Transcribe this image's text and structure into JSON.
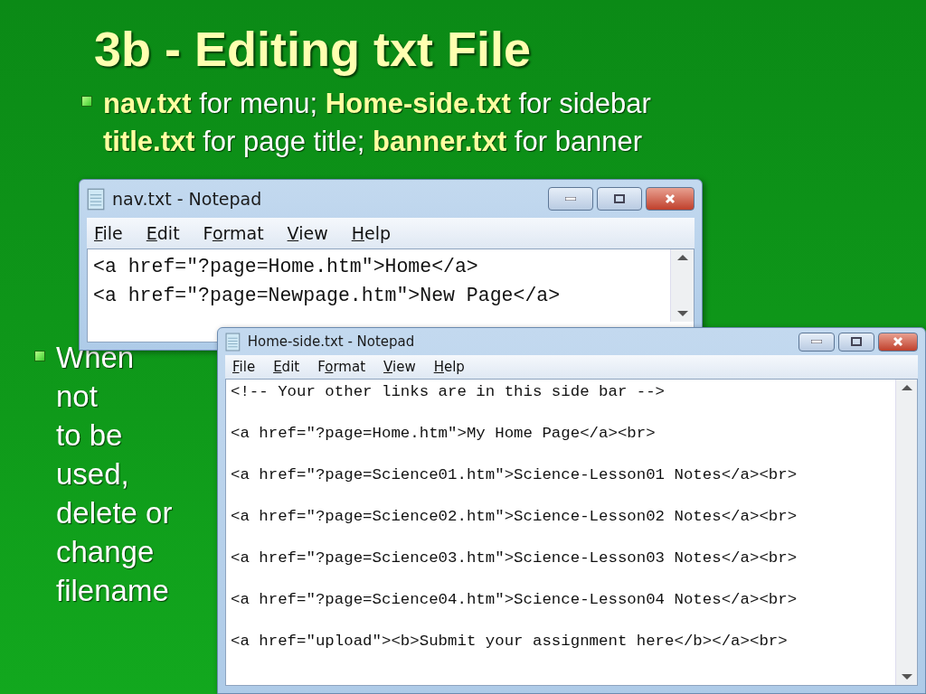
{
  "slide": {
    "title": "3b - Editing txt File",
    "bullets": [
      {
        "lines": [
          "**nav.txt** for menu; **Home-side.txt** for sidebar",
          "**title.txt** for page title; **banner.txt** for banner"
        ]
      },
      {
        "lines": [
          "When",
          "not",
          "to be",
          "used,",
          "delete or",
          "change",
          "filename"
        ]
      }
    ]
  },
  "windows": [
    {
      "title": "nav.txt - Notepad",
      "menu": [
        {
          "key": "F",
          "after": "ile"
        },
        {
          "key": "E",
          "after": "dit"
        },
        {
          "before": "F",
          "key": "o",
          "after": "rmat"
        },
        {
          "key": "V",
          "after": "iew"
        },
        {
          "key": "H",
          "after": "elp"
        }
      ],
      "lines": [
        "<a href=\"?page=Home.htm\">Home</a>",
        "<a href=\"?page=Newpage.htm\">New Page</a>"
      ]
    },
    {
      "title": "Home-side.txt - Notepad",
      "menu": [
        {
          "key": "F",
          "after": "ile"
        },
        {
          "key": "E",
          "after": "dit"
        },
        {
          "before": "F",
          "key": "o",
          "after": "rmat"
        },
        {
          "key": "V",
          "after": "iew"
        },
        {
          "key": "H",
          "after": "elp"
        }
      ],
      "lines": [
        "<!-- Your other links are in this side bar -->",
        "<a href=\"?page=Home.htm\">My Home Page</a><br>",
        "<a href=\"?page=Science01.htm\">Science-Lesson01 Notes</a><br>",
        "<a href=\"?page=Science02.htm\">Science-Lesson02 Notes</a><br>",
        "<a href=\"?page=Science03.htm\">Science-Lesson03 Notes</a><br>",
        "<a href=\"?page=Science04.htm\">Science-Lesson04 Notes</a><br>",
        "<a href=\"upload\"><b>Submit your assignment here</b></a><br>"
      ]
    }
  ]
}
